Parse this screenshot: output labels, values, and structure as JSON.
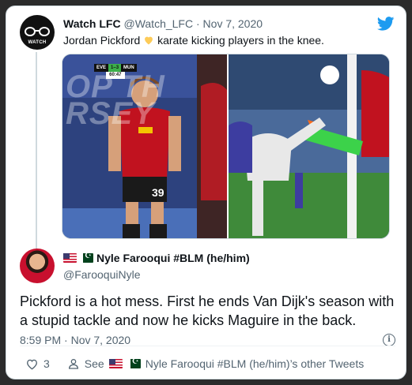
{
  "quoted_tweet": {
    "author_name": "Watch LFC",
    "author_handle": "@Watch_LFC",
    "separator": "·",
    "date": "Nov 7, 2020",
    "text_before": "Jordan Pickford",
    "text_after": "karate kicking players in the knee.",
    "avatar_text": "WATCH",
    "media": {
      "scorebug_home": "EVE",
      "scorebug_score": "1–3",
      "scorebug_away": "MUN",
      "scorebug_time": "60:47",
      "shirt_number": "39"
    }
  },
  "reply": {
    "author_name": "Nyle Farooqui #BLM (he/him)",
    "author_handle": "@FarooquiNyle",
    "text": "Pickford is a hot mess. First he ends Van Dijk's season with a stupid tackle and now he kicks Maguire in the back.",
    "time": "8:59 PM · Nov 7, 2020"
  },
  "actions": {
    "like_count": "3",
    "see_prefix": "See",
    "see_name": "Nyle Farooqui #BLM (he/him)’s other Tweets"
  },
  "colors": {
    "twitter_blue": "#1d9bf0",
    "like_red": "#f91880",
    "muted": "#536471"
  }
}
